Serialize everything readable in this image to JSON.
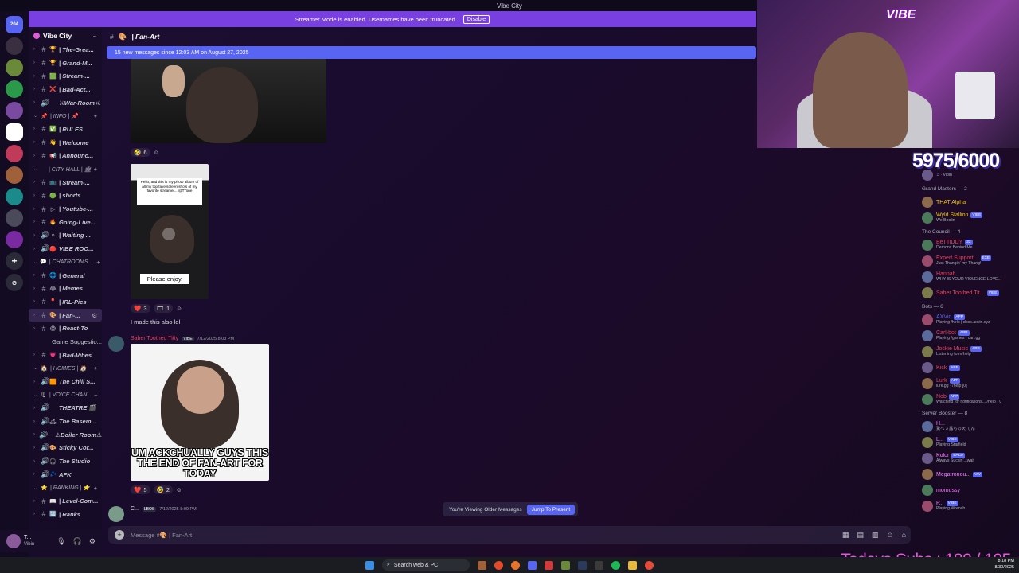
{
  "window": {
    "title": "Vibe City"
  },
  "rail": {
    "badge": "204"
  },
  "banner": {
    "text": "Streamer Mode is enabled. Usernames have been truncated.",
    "disable_label": "Disable"
  },
  "server": {
    "name": "Vibe City"
  },
  "channels": [
    {
      "type": "text",
      "emoji": "🏆",
      "name": "| The-Grea..."
    },
    {
      "type": "text",
      "emoji": "🏆",
      "name": "| Grand-M..."
    },
    {
      "type": "text",
      "emoji": "🟩",
      "name": "| Stream-..."
    },
    {
      "type": "text",
      "emoji": "❌",
      "name": "| Bad-Act..."
    },
    {
      "type": "voice",
      "emoji": "",
      "name": "⚔War-Room⚔"
    },
    {
      "type": "category",
      "emoji": "📌",
      "name": "| INFO | 📌"
    },
    {
      "type": "text",
      "emoji": "✅",
      "name": "| RULES"
    },
    {
      "type": "text",
      "emoji": "👋",
      "name": "| Welcome"
    },
    {
      "type": "text",
      "emoji": "📢",
      "name": "| Announc..."
    },
    {
      "type": "category",
      "emoji": "",
      "name": "| CITY HALL | 🏛"
    },
    {
      "type": "text",
      "emoji": "📺",
      "name": "| Stream-..."
    },
    {
      "type": "text",
      "emoji": "🟢",
      "name": "| shorts"
    },
    {
      "type": "text",
      "emoji": "▷",
      "name": "| Youtube-..."
    },
    {
      "type": "text",
      "emoji": "🔥",
      "name": "Going-Live..."
    },
    {
      "type": "voice",
      "emoji": "⚪",
      "name": "| Waiting ..."
    },
    {
      "type": "voice",
      "emoji": "🔴",
      "name": "VIBE ROO..."
    },
    {
      "type": "category",
      "emoji": "💬",
      "name": "| CHATROOMS ..."
    },
    {
      "type": "text",
      "emoji": "🌐",
      "name": "| General"
    },
    {
      "type": "text",
      "emoji": "😂",
      "name": "| Memes"
    },
    {
      "type": "text",
      "emoji": "📍",
      "name": "| IRL-Pics"
    },
    {
      "type": "text",
      "emoji": "🎨",
      "name": "| Fan-...",
      "selected": true
    },
    {
      "type": "text",
      "emoji": "😱",
      "name": "| React-To"
    },
    {
      "type": "sub",
      "emoji": "",
      "name": "Game Suggestio..."
    },
    {
      "type": "text",
      "emoji": "💗",
      "name": "| Bad-Vibes"
    },
    {
      "type": "category",
      "emoji": "🏠",
      "name": "| HOMIES | 🏠"
    },
    {
      "type": "voice",
      "emoji": "🟧",
      "name": "The Chill S..."
    },
    {
      "type": "category",
      "emoji": "🎙",
      "name": "| VOICE CHAN..."
    },
    {
      "type": "voice",
      "emoji": "",
      "name": "THEATRE 🎬"
    },
    {
      "type": "voice",
      "emoji": "🛋",
      "name": "The Basem..."
    },
    {
      "type": "voice",
      "emoji": "",
      "name": "⚠Boiler Room⚠"
    },
    {
      "type": "voice",
      "emoji": "🎨",
      "name": "Sticky Cor..."
    },
    {
      "type": "voice",
      "emoji": "🎧",
      "name": "The Studio"
    },
    {
      "type": "voice",
      "emoji": "💤",
      "name": "AFK"
    },
    {
      "type": "category",
      "emoji": "⭐",
      "name": "| RANKING | ⭐"
    },
    {
      "type": "text",
      "emoji": "📖",
      "name": "| Level-Com..."
    },
    {
      "type": "text",
      "emoji": "🔢",
      "name": "| Ranks"
    }
  ],
  "user": {
    "name": "T...",
    "status": "Vibin"
  },
  "channel_header": {
    "emoji": "🎨",
    "name": "| Fan-Art"
  },
  "new_messages": {
    "text": "15 new messages since 12:03 AM on August 27, 2025"
  },
  "messages": {
    "reactions1": [
      {
        "emoji": "🤣",
        "count": "6"
      }
    ],
    "video": {
      "caption": "Hello, and this is my photo album of all my top fave screen shots of my favorite streamer... @TTone",
      "enjoy": "Please enjoy."
    },
    "reactions2": [
      {
        "emoji": "❤️",
        "count": "3"
      },
      {
        "emoji": "🎞",
        "count": "1"
      }
    ],
    "text1": "I made this also lol",
    "author2": {
      "name": "Saber Toothed Titty",
      "tag": "VIBE",
      "time": "7/12/2025 8:03 PM"
    },
    "meme_caption": "UM ACKCHUALLY GUYS THIS THE END OF FAN-ART FOR TODAY",
    "reactions3": [
      {
        "emoji": "❤️",
        "count": "5"
      },
      {
        "emoji": "🤣",
        "count": "2"
      }
    ],
    "author3": {
      "name": "C...",
      "tag": "LBOS",
      "time": "7/12/2025 8:09 PM"
    }
  },
  "older_bar": {
    "text": "You're Viewing Older Messages",
    "jump_label": "Jump To Present"
  },
  "composer": {
    "placeholder": "Message #🎨 | Fan-Art"
  },
  "overlay": {
    "subgoal": "5975/6000",
    "todays_subs": "Todays Subs : 189 / 195"
  },
  "members": [
    {
      "group": "",
      "items": [
        {
          "name": "",
          "status": "♫ · Vibin",
          "color": "#dcddde"
        }
      ]
    },
    {
      "group": "Grand Masters — 2",
      "items": [
        {
          "name": "THAT Alpha",
          "status": "",
          "color": "#f1c40f",
          "tag": ""
        },
        {
          "name": "Wyld Stallion",
          "status": "We Boolin",
          "color": "#f1c40f",
          "tag": "VIBE"
        }
      ]
    },
    {
      "group": "The Council — 4",
      "items": [
        {
          "name": "BeTTiDDY",
          "status": "Demons Behind Me",
          "color": "#e2435e",
          "tag": "22"
        },
        {
          "name": "Expert Support...",
          "status": "Just Thangin' my Thang!",
          "color": "#e2435e",
          "tag": "EXE"
        },
        {
          "name": "Hannah",
          "status": "WHY IS YOUR VIOLENCE LOVE...",
          "color": "#e2435e",
          "tag": ""
        },
        {
          "name": "Saber Toothed Tit...",
          "status": "",
          "color": "#e2435e",
          "tag": "VIBE"
        }
      ]
    },
    {
      "group": "Bots — 6",
      "items": [
        {
          "name": "AXVin",
          "status": "Playing /help | docs.axvin.xyz",
          "color": "#5865f2",
          "tag": "APP"
        },
        {
          "name": "Carl-bot",
          "status": "Playing /games | carl.gg",
          "color": "#e2435e",
          "tag": "APP"
        },
        {
          "name": "Jockie Music",
          "status": "Listening to m!help",
          "color": "#e2435e",
          "tag": "APP"
        },
        {
          "name": "Kick",
          "status": "",
          "color": "#e2435e",
          "tag": "APP"
        },
        {
          "name": "Lurk",
          "status": "lurk.gg · /help [0]",
          "color": "#e2435e",
          "tag": "APP"
        },
        {
          "name": "Nob",
          "status": "Watching for notifications... /help · 0",
          "color": "#e2435e",
          "tag": "APP"
        }
      ]
    },
    {
      "group": "Server Booster — 8",
      "items": [
        {
          "name": "H...",
          "status": "驚べ 3 露らの天 てん",
          "color": "#f47fff",
          "tag": ""
        },
        {
          "name": "L...",
          "status": "Playing Starfield",
          "color": "#f47fff",
          "tag": "VIBE"
        },
        {
          "name": "Kolor",
          "status": "Always Suckin'...wait",
          "color": "#f47fff",
          "tag": "BALD"
        },
        {
          "name": "Megatronou...",
          "status": "",
          "color": "#f47fff",
          "tag": "VIV"
        },
        {
          "name": "momussy",
          "status": "",
          "color": "#f47fff",
          "tag": ""
        },
        {
          "name": "P...",
          "status": "Playing Wrench",
          "color": "#f47fff",
          "tag": "VIBE"
        }
      ]
    }
  ],
  "taskbar": {
    "search": "Search web & PC",
    "time": "8:18 PM",
    "date": "8/30/2025"
  }
}
